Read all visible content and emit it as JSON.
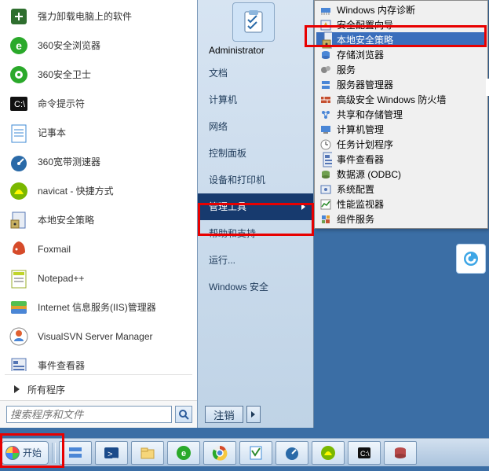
{
  "left_apps": [
    {
      "label": "强力卸载电脑上的软件",
      "icon": "uninstall",
      "color": "#2e6e2e"
    },
    {
      "label": "360安全浏览器",
      "icon": "browser",
      "color": "#2aa92a"
    },
    {
      "label": "360安全卫士",
      "icon": "shield",
      "color": "#2aa92a"
    },
    {
      "label": "命令提示符",
      "icon": "cmd",
      "color": "#111"
    },
    {
      "label": "记事本",
      "icon": "notepad",
      "color": "#3e8ad6"
    },
    {
      "label": "360宽带测速器",
      "icon": "speed",
      "color": "#2a6aa8"
    },
    {
      "label": "navicat - 快捷方式",
      "icon": "navicat",
      "color": "#7ab800"
    },
    {
      "label": "本地安全策略",
      "icon": "policy",
      "color": "#5576b5"
    },
    {
      "label": "Foxmail",
      "icon": "foxmail",
      "color": "#d64b2a"
    },
    {
      "label": "Notepad++",
      "icon": "npp",
      "color": "#c0d42a"
    },
    {
      "label": "Internet 信息服务(IIS)管理器",
      "icon": "iis",
      "color": "#e0a030"
    },
    {
      "label": "VisualSVN Server Manager",
      "icon": "svn",
      "color": "#e06030"
    },
    {
      "label": "事件查看器",
      "icon": "event",
      "color": "#5576b5"
    }
  ],
  "all_programs_label": "所有程序",
  "search": {
    "placeholder": "搜索程序和文件"
  },
  "right_labels": {
    "user": "Administrator",
    "items": [
      "文档",
      "计算机",
      "网络",
      "控制面板",
      "设备和打印机",
      "管理工具",
      "帮助和支持",
      "运行...",
      "Windows 安全"
    ],
    "selected_index": 5
  },
  "logoff_label": "注销",
  "submenu": {
    "items": [
      {
        "label": "Windows 内存诊断",
        "icon": "memory"
      },
      {
        "label": "安全配置向导",
        "icon": "wizard"
      },
      {
        "label": "本地安全策略",
        "icon": "policy",
        "selected": true
      },
      {
        "label": "存储浏览器",
        "icon": "storage"
      },
      {
        "label": "服务",
        "icon": "gears"
      },
      {
        "label": "服务器管理器",
        "icon": "server"
      },
      {
        "label": "高级安全 Windows 防火墙",
        "icon": "firewall"
      },
      {
        "label": "共享和存储管理",
        "icon": "share"
      },
      {
        "label": "计算机管理",
        "icon": "computer"
      },
      {
        "label": "任务计划程序",
        "icon": "task"
      },
      {
        "label": "事件查看器",
        "icon": "event"
      },
      {
        "label": "数据源 (ODBC)",
        "icon": "odbc"
      },
      {
        "label": "系统配置",
        "icon": "sysconfig"
      },
      {
        "label": "性能监视器",
        "icon": "perf"
      },
      {
        "label": "组件服务",
        "icon": "component"
      }
    ]
  },
  "taskbar": {
    "start_label": "开始",
    "items": [
      "server",
      "powershell",
      "explorer",
      "browser360",
      "chrome",
      "notepad",
      "speed",
      "navicat",
      "cmd",
      "sql"
    ]
  }
}
